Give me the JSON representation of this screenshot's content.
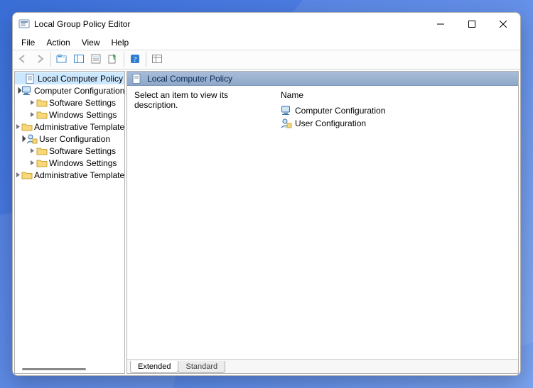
{
  "window": {
    "title": "Local Group Policy Editor"
  },
  "menubar": {
    "items": [
      "File",
      "Action",
      "View",
      "Help"
    ]
  },
  "tree": {
    "root": {
      "label": "Local Computer Policy",
      "selected": true,
      "children": [
        {
          "label": "Computer Configuration",
          "icon": "computer-config",
          "expanded": true,
          "children": [
            {
              "label": "Software Settings",
              "icon": "folder"
            },
            {
              "label": "Windows Settings",
              "icon": "folder"
            },
            {
              "label": "Administrative Templates",
              "icon": "folder"
            }
          ]
        },
        {
          "label": "User Configuration",
          "icon": "user-config",
          "expanded": true,
          "children": [
            {
              "label": "Software Settings",
              "icon": "folder"
            },
            {
              "label": "Windows Settings",
              "icon": "folder"
            },
            {
              "label": "Administrative Templates",
              "icon": "folder"
            }
          ]
        }
      ]
    }
  },
  "detail": {
    "header": "Local Computer Policy",
    "description": "Select an item to view its description.",
    "column_header": "Name",
    "items": [
      {
        "label": "Computer Configuration",
        "icon": "computer-config"
      },
      {
        "label": "User Configuration",
        "icon": "user-config"
      }
    ],
    "tabs": {
      "extended": "Extended",
      "standard": "Standard",
      "active": "extended"
    }
  }
}
